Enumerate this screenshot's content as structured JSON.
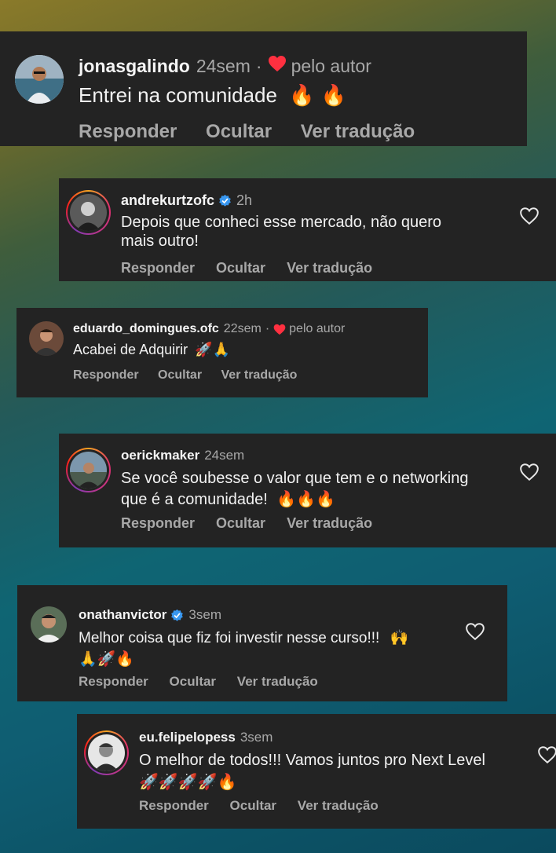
{
  "comments": [
    {
      "user": "jonasgalindo",
      "time": "24sem",
      "dot": "·",
      "liked_by_author": "pelo autor",
      "text": "Entrei na comunidade",
      "emoji": "🔥 🔥",
      "actions": [
        "Responder",
        "Ocultar",
        "Ver tradução"
      ]
    },
    {
      "user": "andrekurtzofc",
      "verified": true,
      "time": "2h",
      "text1": "Depois que conheci esse mercado, não quero",
      "text2": "mais outro!",
      "actions": [
        "Responder",
        "Ocultar",
        "Ver tradução"
      ]
    },
    {
      "user": "eduardo_domingues.ofc",
      "time": "22sem",
      "dot": "·",
      "liked_by_author": "pelo autor",
      "text": "Acabei de Adquirir",
      "emoji": "🚀🙏",
      "actions": [
        "Responder",
        "Ocultar",
        "Ver tradução"
      ]
    },
    {
      "user": "oerickmaker",
      "time": "24sem",
      "text1": "Se você soubesse o valor que tem e o networking",
      "text2": "que é a comunidade!",
      "emoji": "🔥🔥🔥",
      "actions": [
        "Responder",
        "Ocultar",
        "Ver tradução"
      ]
    },
    {
      "user": "onathanvictor",
      "verified": true,
      "time": "3sem",
      "text1": "Melhor coisa que fiz foi investir nesse curso!!!",
      "emoji1": "🙌",
      "emoji2": "🙏🚀🔥",
      "actions": [
        "Responder",
        "Ocultar",
        "Ver tradução"
      ]
    },
    {
      "user": "eu.felipelopess",
      "time": "3sem",
      "text1": "O melhor de todos!!! Vamos juntos pro Next Level",
      "emoji2": "🚀🚀🚀🚀🔥",
      "actions": [
        "Responder",
        "Ocultar",
        "Ver tradução"
      ]
    }
  ],
  "colors": {
    "card": "#232323",
    "secondary": "#a8a8a8",
    "heart": "#ff3040",
    "verified": "#3897f0"
  }
}
